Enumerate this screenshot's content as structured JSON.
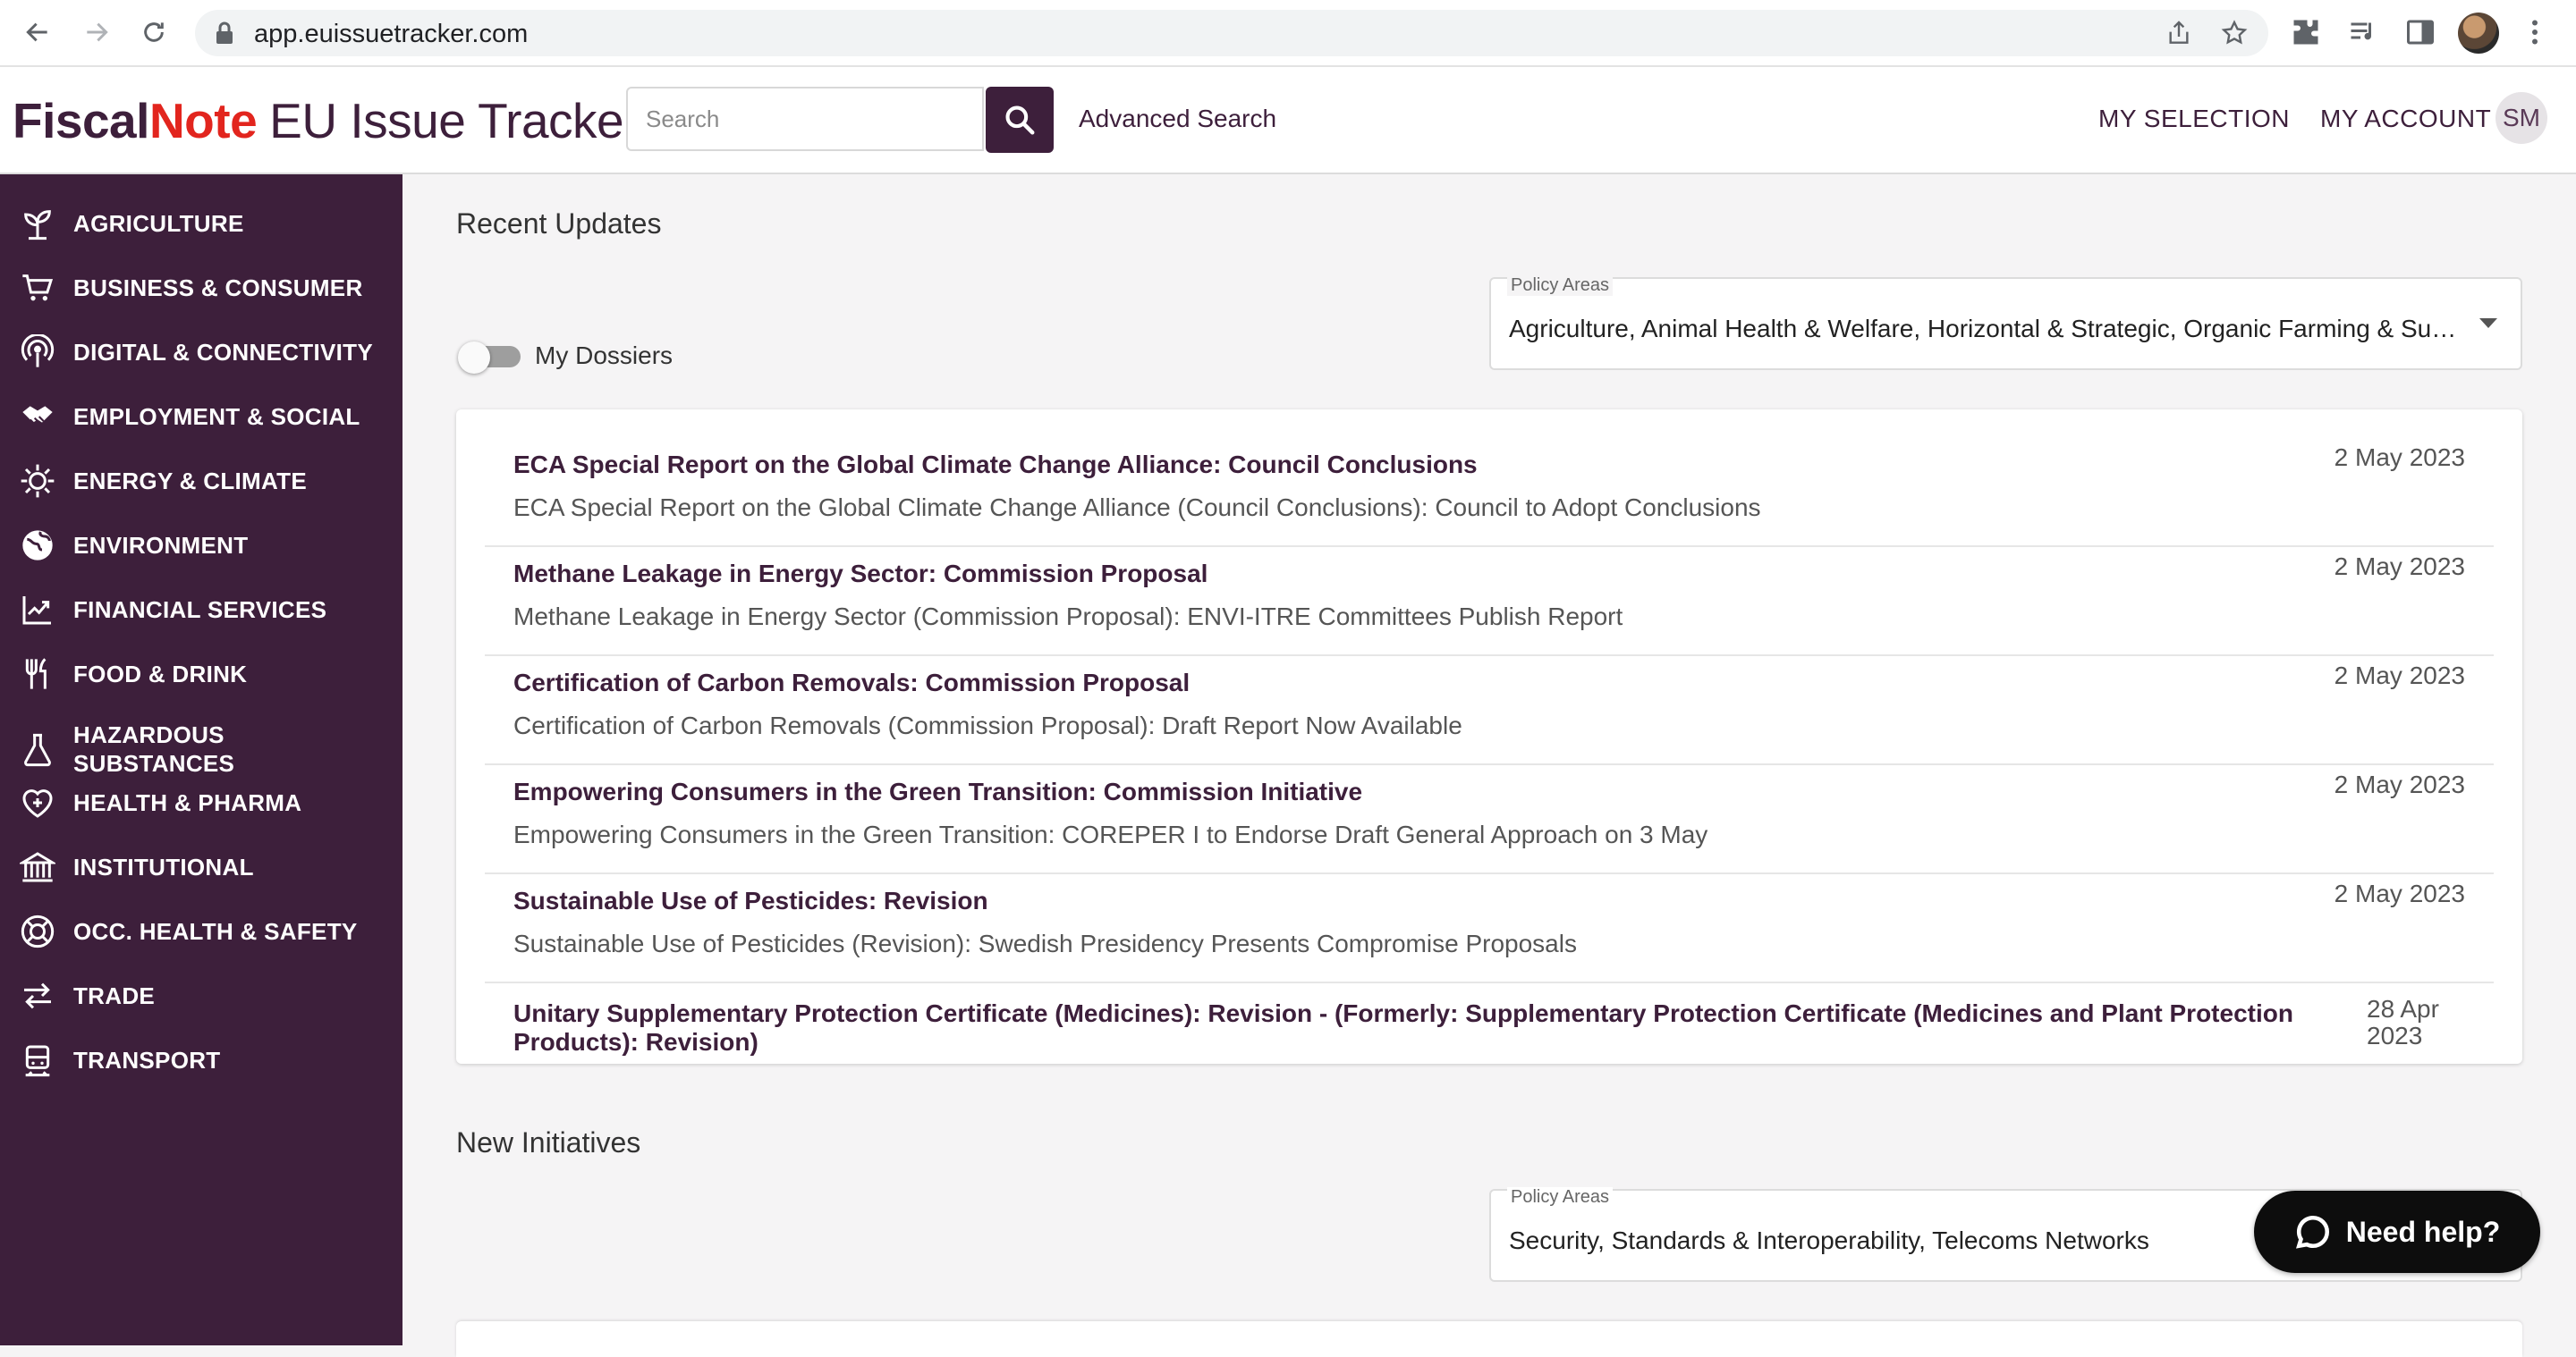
{
  "browser": {
    "url": "app.euissuetracker.com"
  },
  "header": {
    "logo_fiscal": "Fiscal",
    "logo_note": "Note",
    "logo_product": "EU Issue Tracker",
    "search_placeholder": "Search",
    "advanced_search": "Advanced Search",
    "my_selection": "MY SELECTION",
    "my_account": "MY ACCOUNT",
    "avatar_initials": "SM"
  },
  "sidebar": {
    "items": [
      {
        "label": "AGRICULTURE",
        "icon": "sprout-icon"
      },
      {
        "label": "BUSINESS & CONSUMER",
        "icon": "cart-icon"
      },
      {
        "label": "DIGITAL & CONNECTIVITY",
        "icon": "broadcast-icon"
      },
      {
        "label": "EMPLOYMENT & SOCIAL",
        "icon": "handshake-icon"
      },
      {
        "label": "ENERGY & CLIMATE",
        "icon": "sun-icon"
      },
      {
        "label": "ENVIRONMENT",
        "icon": "globe-icon"
      },
      {
        "label": "FINANCIAL SERVICES",
        "icon": "chart-icon"
      },
      {
        "label": "FOOD & DRINK",
        "icon": "utensils-icon"
      },
      {
        "label": "HAZARDOUS SUBSTANCES",
        "icon": "flask-icon"
      },
      {
        "label": "HEALTH & PHARMA",
        "icon": "heart-plus-icon"
      },
      {
        "label": "INSTITUTIONAL",
        "icon": "building-icon"
      },
      {
        "label": "OCC. HEALTH & SAFETY",
        "icon": "lifebuoy-icon"
      },
      {
        "label": "TRADE",
        "icon": "arrows-icon"
      },
      {
        "label": "TRANSPORT",
        "icon": "train-icon"
      }
    ]
  },
  "recent_updates": {
    "title": "Recent Updates",
    "policy_areas_label": "Policy Areas",
    "policy_areas_value": "Agriculture, Animal Health & Welfare, Horizontal & Strategic, Organic Farming & Sustai...",
    "my_dossiers_label": "My Dossiers",
    "my_dossiers_on": false,
    "items": [
      {
        "title": "ECA Special Report on the Global Climate Change Alliance: Council Conclusions",
        "subtitle": "ECA Special Report on the Global Climate Change Alliance (Council Conclusions): Council to Adopt Conclusions",
        "date": "2 May 2023"
      },
      {
        "title": "Methane Leakage in Energy Sector: Commission Proposal",
        "subtitle": "Methane Leakage in Energy Sector (Commission Proposal): ENVI-ITRE Committees Publish Report",
        "date": "2 May 2023"
      },
      {
        "title": "Certification of Carbon Removals: Commission Proposal",
        "subtitle": "Certification of Carbon Removals (Commission Proposal): Draft Report Now Available",
        "date": "2 May 2023"
      },
      {
        "title": "Empowering Consumers in the Green Transition: Commission Initiative",
        "subtitle": "Empowering Consumers in the Green Transition: COREPER I to Endorse Draft General Approach on 3 May",
        "date": "2 May 2023"
      },
      {
        "title": "Sustainable Use of Pesticides: Revision",
        "subtitle": "Sustainable Use of Pesticides (Revision): Swedish Presidency Presents Compromise Proposals",
        "date": "2 May 2023"
      },
      {
        "title": "Unitary Supplementary Protection Certificate (Medicines): Revision - (Formerly: Supplementary Protection Certificate (Medicines and Plant Protection Products): Revision)",
        "subtitle": "",
        "date": "28 Apr 2023"
      }
    ]
  },
  "new_initiatives": {
    "title": "New Initiatives",
    "policy_areas_label": "Policy Areas",
    "policy_areas_value": "Security, Standards & Interoperability, Telecoms Networks"
  },
  "help": {
    "label": "Need help?"
  },
  "colors": {
    "brand": "#3d1f3b",
    "accent": "#e2251e"
  }
}
